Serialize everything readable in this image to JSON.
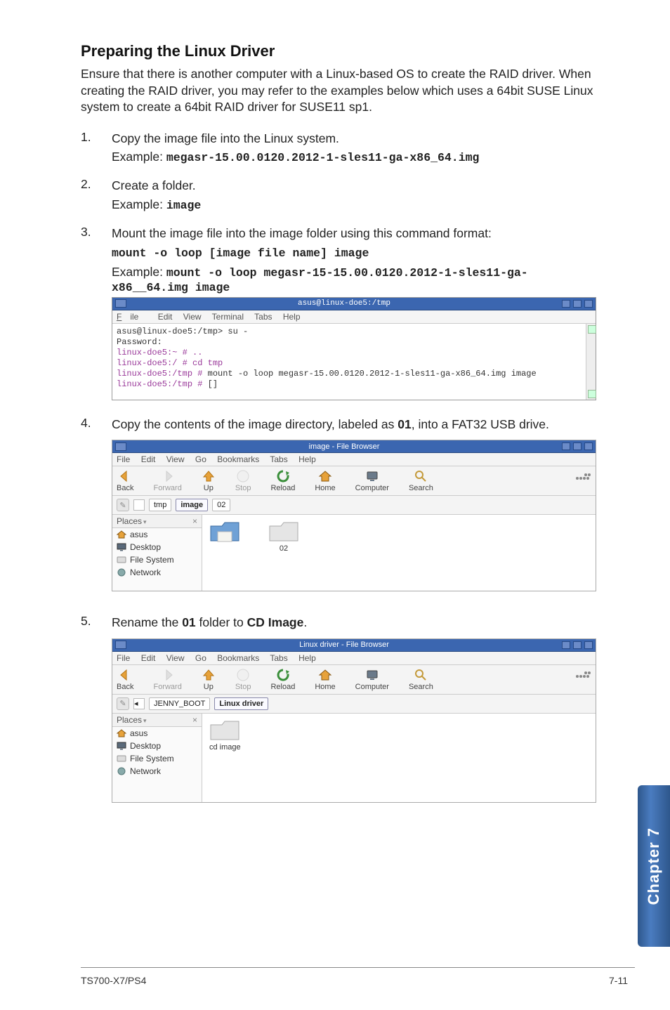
{
  "section_title": "Preparing the Linux Driver",
  "intro": "Ensure that there is another computer with a Linux-based OS to create the RAID driver. When creating the RAID driver, you may refer to the examples below which uses a 64bit SUSE Linux system to create a 64bit RAID driver for SUSE11 sp1.",
  "example_label": "Example:",
  "steps": {
    "s1": {
      "num": "1.",
      "text": "Copy the image file into the Linux system.",
      "example_code": "megasr-15.00.0120.2012-1-sles11-ga-x86_64.img"
    },
    "s2": {
      "num": "2.",
      "text": "Create a folder.",
      "example_code": "image"
    },
    "s3": {
      "num": "3.",
      "text": "Mount the image file into the image folder using this command format:",
      "cmd_format": "mount -o loop [image file name] image",
      "example_code": "mount -o loop megasr-15-15.00.0120.2012-1-sles11-ga-x86__64.img image"
    },
    "s4": {
      "num": "4.",
      "text_before": "Copy the contents of the image directory, labeled as ",
      "bold1": "01",
      "text_mid": ", into  a FAT32 USB drive."
    },
    "s5": {
      "num": "5.",
      "text_before": "Rename the ",
      "bold1": "01",
      "text_mid": " folder to ",
      "bold2": "CD Image",
      "text_after": "."
    }
  },
  "terminal": {
    "title": "asus@linux-doe5:/tmp",
    "menu": {
      "file": "File",
      "edit": "Edit",
      "view": "View",
      "terminal": "Terminal",
      "tabs": "Tabs",
      "help": "Help"
    },
    "lines": {
      "l1": "asus@linux-doe5:/tmp> su -",
      "l2": "Password:",
      "l3": "linux-doe5:~ # ..",
      "l4": "linux-doe5:/ # cd tmp",
      "l5a": "linux-doe5:/tmp #",
      "l5b": " mount -o loop megasr-15.00.0120.2012-1-sles11-ga-x86_64.img image",
      "l6a": "linux-doe5:/tmp #",
      "l6b": " []"
    }
  },
  "fb_common": {
    "menu": {
      "file": "File",
      "edit": "Edit",
      "view": "View",
      "go": "Go",
      "bookmarks": "Bookmarks",
      "tabs": "Tabs",
      "help": "Help"
    },
    "toolbar": {
      "back": "Back",
      "forward": "Forward",
      "up": "Up",
      "stop": "Stop",
      "reload": "Reload",
      "home": "Home",
      "computer": "Computer",
      "search": "Search"
    },
    "places": "Places",
    "side": {
      "asus": "asus",
      "desktop": "Desktop",
      "fs": "File System",
      "network": "Network"
    }
  },
  "fb1": {
    "title": "image - File Browser",
    "crumb1": "tmp",
    "crumb2": "image",
    "crumb3": "02",
    "folder2": "02"
  },
  "fb2": {
    "title": "Linux driver - File Browser",
    "crumb1": "JENNY_BOOT",
    "crumb2": "Linux driver",
    "folder1": "cd image"
  },
  "side_tab": "Chapter 7",
  "footer_left": "TS700-X7/PS4",
  "footer_right": "7-11"
}
